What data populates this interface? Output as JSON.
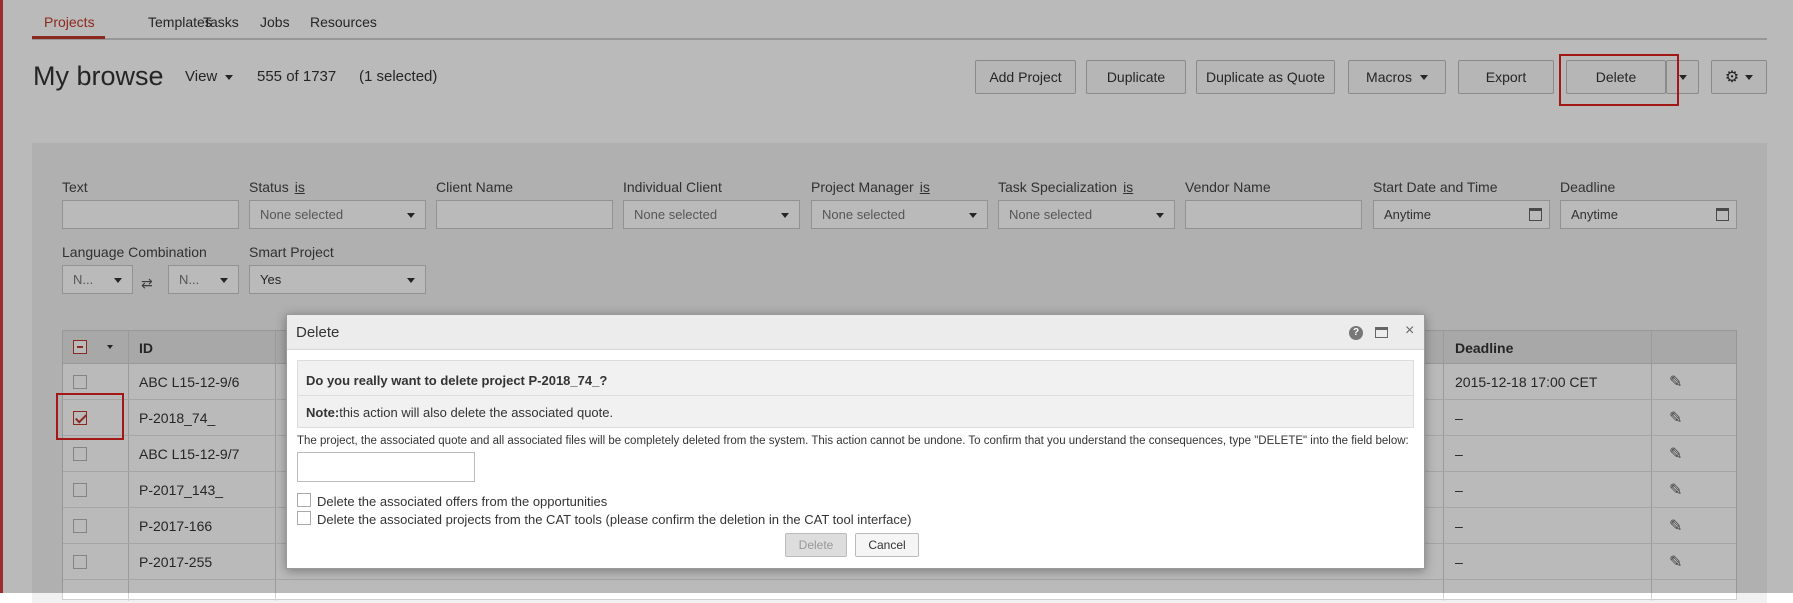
{
  "nav": {
    "tabs": [
      "Projects",
      "Templates",
      "Tasks",
      "Jobs",
      "Resources"
    ],
    "active": "Projects"
  },
  "header": {
    "title": "My browse",
    "view_label": "View",
    "count": "555 of 1737",
    "selected": "(1 selected)"
  },
  "toolbar": {
    "add_project": "Add Project",
    "duplicate": "Duplicate",
    "duplicate_as_quote": "Duplicate as Quote",
    "macros": "Macros",
    "export": "Export",
    "delete": "Delete",
    "settings_icon": "gear-icon"
  },
  "filters": {
    "text": {
      "label": "Text",
      "value": ""
    },
    "status": {
      "label": "Status",
      "op": "is",
      "value": "None selected"
    },
    "client_name": {
      "label": "Client Name",
      "value": ""
    },
    "individual_client": {
      "label": "Individual Client",
      "value": "None selected"
    },
    "project_manager": {
      "label": "Project Manager",
      "op": "is",
      "value": "None selected"
    },
    "task_specialization": {
      "label": "Task Specialization",
      "op": "is",
      "value": "None selected"
    },
    "vendor_name": {
      "label": "Vendor Name",
      "value": ""
    },
    "start_date": {
      "label": "Start Date and Time",
      "value": "Anytime"
    },
    "deadline": {
      "label": "Deadline",
      "value": "Anytime"
    },
    "language_combination": {
      "label": "Language Combination",
      "source": "N...",
      "target": "N..."
    },
    "smart_project": {
      "label": "Smart Project",
      "value": "Yes"
    }
  },
  "table": {
    "columns": {
      "id": "ID",
      "deadline": "Deadline"
    },
    "rows": [
      {
        "id": "ABC L15-12-9/6",
        "deadline": "2015-12-18 17:00 CET",
        "checked": false
      },
      {
        "id": "P-2018_74_",
        "deadline": "–",
        "checked": true
      },
      {
        "id": "ABC L15-12-9/7",
        "deadline": "–",
        "checked": false
      },
      {
        "id": "P-2017_143_",
        "deadline": "–",
        "checked": false
      },
      {
        "id": "P-2017-166",
        "deadline": "–",
        "checked": false
      },
      {
        "id": "P-2017-255",
        "deadline": "–",
        "checked": false
      }
    ]
  },
  "dialog": {
    "title": "Delete",
    "question": "Do you really want to delete project P-2018_74_?",
    "note_label": "Note:",
    "note_text": "this action will also delete the associated quote.",
    "description": "The project, the associated quote and all associated files will be completely deleted from the system. This action cannot be undone. To confirm that you understand the consequences, type \"DELETE\" into the field below:",
    "input_value": "",
    "options": [
      "Delete the associated offers from the opportunities",
      "Delete the associated projects from the CAT tools (please confirm the deletion in the CAT tool interface)"
    ],
    "delete_label": "Delete",
    "cancel_label": "Cancel"
  },
  "colors": {
    "accent": "#c0392b",
    "highlight": "#e02020"
  }
}
